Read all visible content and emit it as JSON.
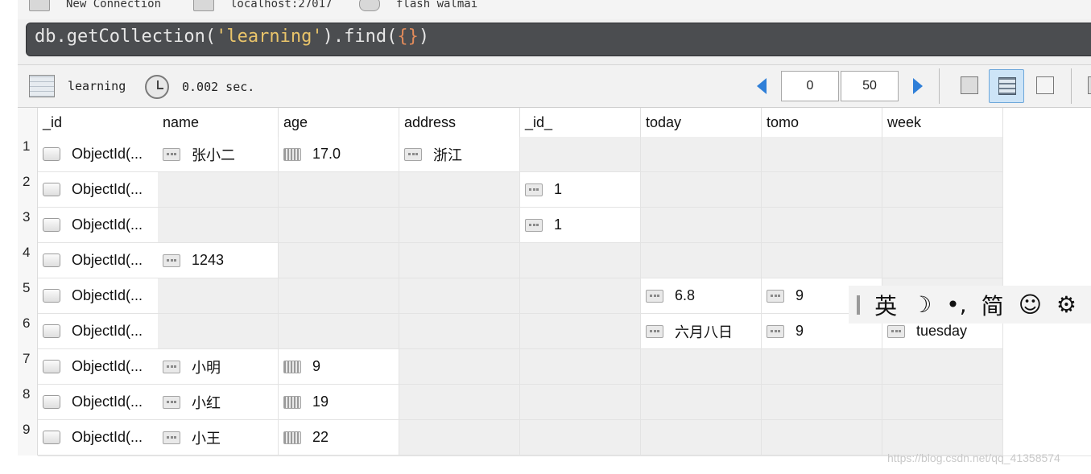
{
  "connection_bar": {
    "connection": "New Connection",
    "host": "localhost:27017",
    "database": "flash walmai"
  },
  "query": {
    "prefix": "db.getCollection(",
    "collection_literal": "'learning'",
    "middle": ").find(",
    "braces": "{}",
    "suffix": ")"
  },
  "toolbar": {
    "collection": "learning",
    "time": "0.002 sec.",
    "skip": "0",
    "limit": "50"
  },
  "grid": {
    "columns": [
      "_id",
      "name",
      "age",
      "address",
      "_id_",
      "today",
      "tomo",
      "week"
    ],
    "row_numbers": [
      "1",
      "2",
      "3",
      "4",
      "5",
      "6",
      "7",
      "8",
      "9"
    ],
    "rows": [
      {
        "id": "ObjectId(...",
        "name": "张小二",
        "age": "17.0",
        "address": "浙江"
      },
      {
        "id": "ObjectId(...",
        "id_": "1"
      },
      {
        "id": "ObjectId(...",
        "id_": "1"
      },
      {
        "id": "ObjectId(...",
        "name": "1243"
      },
      {
        "id": "ObjectId(...",
        "today": "6.8",
        "tomo": "9"
      },
      {
        "id": "ObjectId(...",
        "today": "六月八日",
        "tomo": "9",
        "week": "tuesday"
      },
      {
        "id": "ObjectId(...",
        "name": "小明",
        "age": "9"
      },
      {
        "id": "ObjectId(...",
        "name": "小红",
        "age": "19"
      },
      {
        "id": "ObjectId(...",
        "name": "小王",
        "age": "22"
      }
    ]
  },
  "ime": {
    "lang": "英",
    "moon": "☽",
    "punct": "•,",
    "mode": "简",
    "emoji": "☺",
    "gear": "⚙"
  },
  "watermark": "https://blog.csdn.net/qq_41358574"
}
